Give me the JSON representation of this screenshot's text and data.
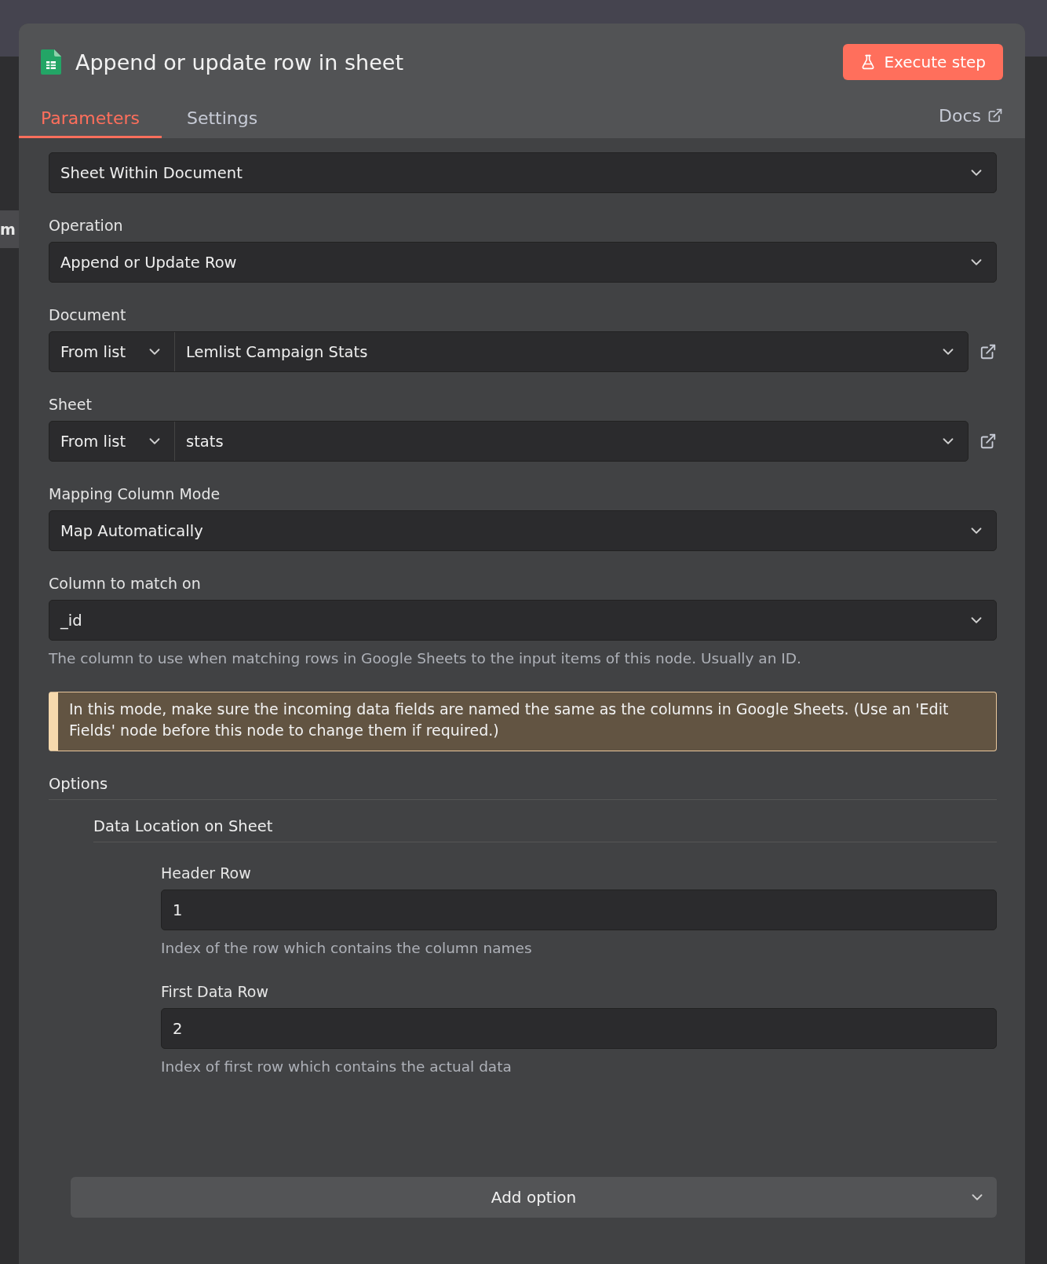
{
  "backdrop": {
    "cut_label": "m"
  },
  "panel": {
    "title": "Append or update row in sheet",
    "execute_button": "Execute step",
    "tabs": [
      {
        "label": "Parameters",
        "selected": true
      },
      {
        "label": "Settings",
        "selected": false
      }
    ],
    "docs_link": "Docs"
  },
  "fields": [
    {
      "kind": "select",
      "value": "Sheet Within Document"
    },
    {
      "kind": "select",
      "label": "Operation",
      "value": "Append or Update Row"
    },
    {
      "kind": "resource",
      "label": "Document",
      "mode": "From list",
      "value": "Lemlist Campaign Stats"
    },
    {
      "kind": "resource",
      "label": "Sheet",
      "mode": "From list",
      "value": "stats"
    },
    {
      "kind": "select",
      "label": "Mapping Column Mode",
      "value": "Map Automatically"
    },
    {
      "kind": "select",
      "label": "Column to match on",
      "value": "_id",
      "hint": "The column to use when matching rows in Google Sheets to the input items of this node. Usually an ID."
    }
  ],
  "notice": "In this mode, make sure the incoming data fields are named the same as the columns in Google Sheets. (Use an 'Edit Fields' node before this node to change them if required.)",
  "options": {
    "title": "Options",
    "group": "Data Location on Sheet",
    "items": [
      {
        "label": "Header Row",
        "value": "1",
        "hint": "Index of the row which contains the column names"
      },
      {
        "label": "First Data Row",
        "value": "2",
        "hint": "Index of first row which contains the actual data"
      }
    ],
    "add_button": "Add option"
  }
}
